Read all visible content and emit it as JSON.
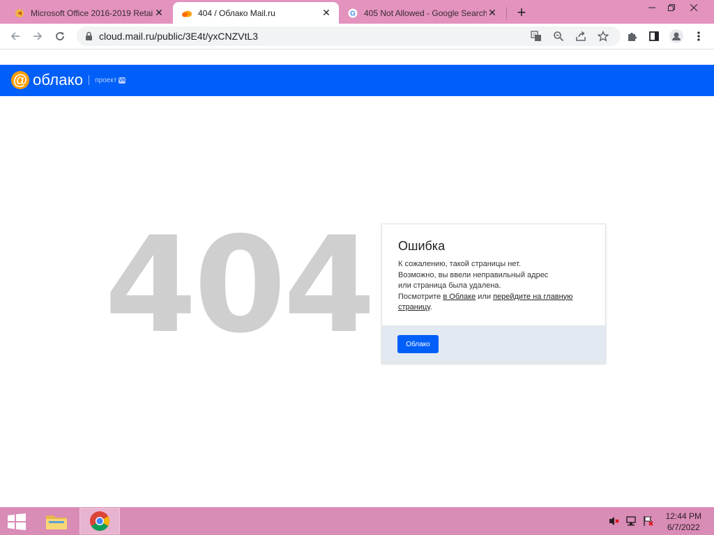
{
  "browser": {
    "tabs": [
      {
        "title": "Microsoft Office 2016-2019 Retail",
        "favicon": "office-favicon-icon",
        "active": false
      },
      {
        "title": "404 / Облако Mail.ru",
        "favicon": "cloud-favicon-icon",
        "active": true
      },
      {
        "title": "405 Not Allowed - Google Search",
        "favicon": "google-favicon-icon",
        "active": false
      }
    ],
    "new_tab_label": "+",
    "url": "cloud.mail.ru/public/3E4t/yxCNZVtL3"
  },
  "site": {
    "logo_text": "облако",
    "logo_sub": "проект",
    "logo_vk": "VK",
    "accent_color": "#005ff9"
  },
  "error": {
    "code": "404",
    "title": "Ошибка",
    "lines": [
      "К сожалению, такой страницы нет.",
      "Возможно, вы ввели неправильный адрес",
      "или страница была удалена."
    ],
    "see_prefix": "Посмотрите",
    "link_cloud": "в Облаке",
    "or_text": "или",
    "link_home": "перейдите на главную страницу",
    "period": ".",
    "button_label": "Облако"
  },
  "taskbar": {
    "time": "12:44 PM",
    "date": "6/7/2022"
  }
}
